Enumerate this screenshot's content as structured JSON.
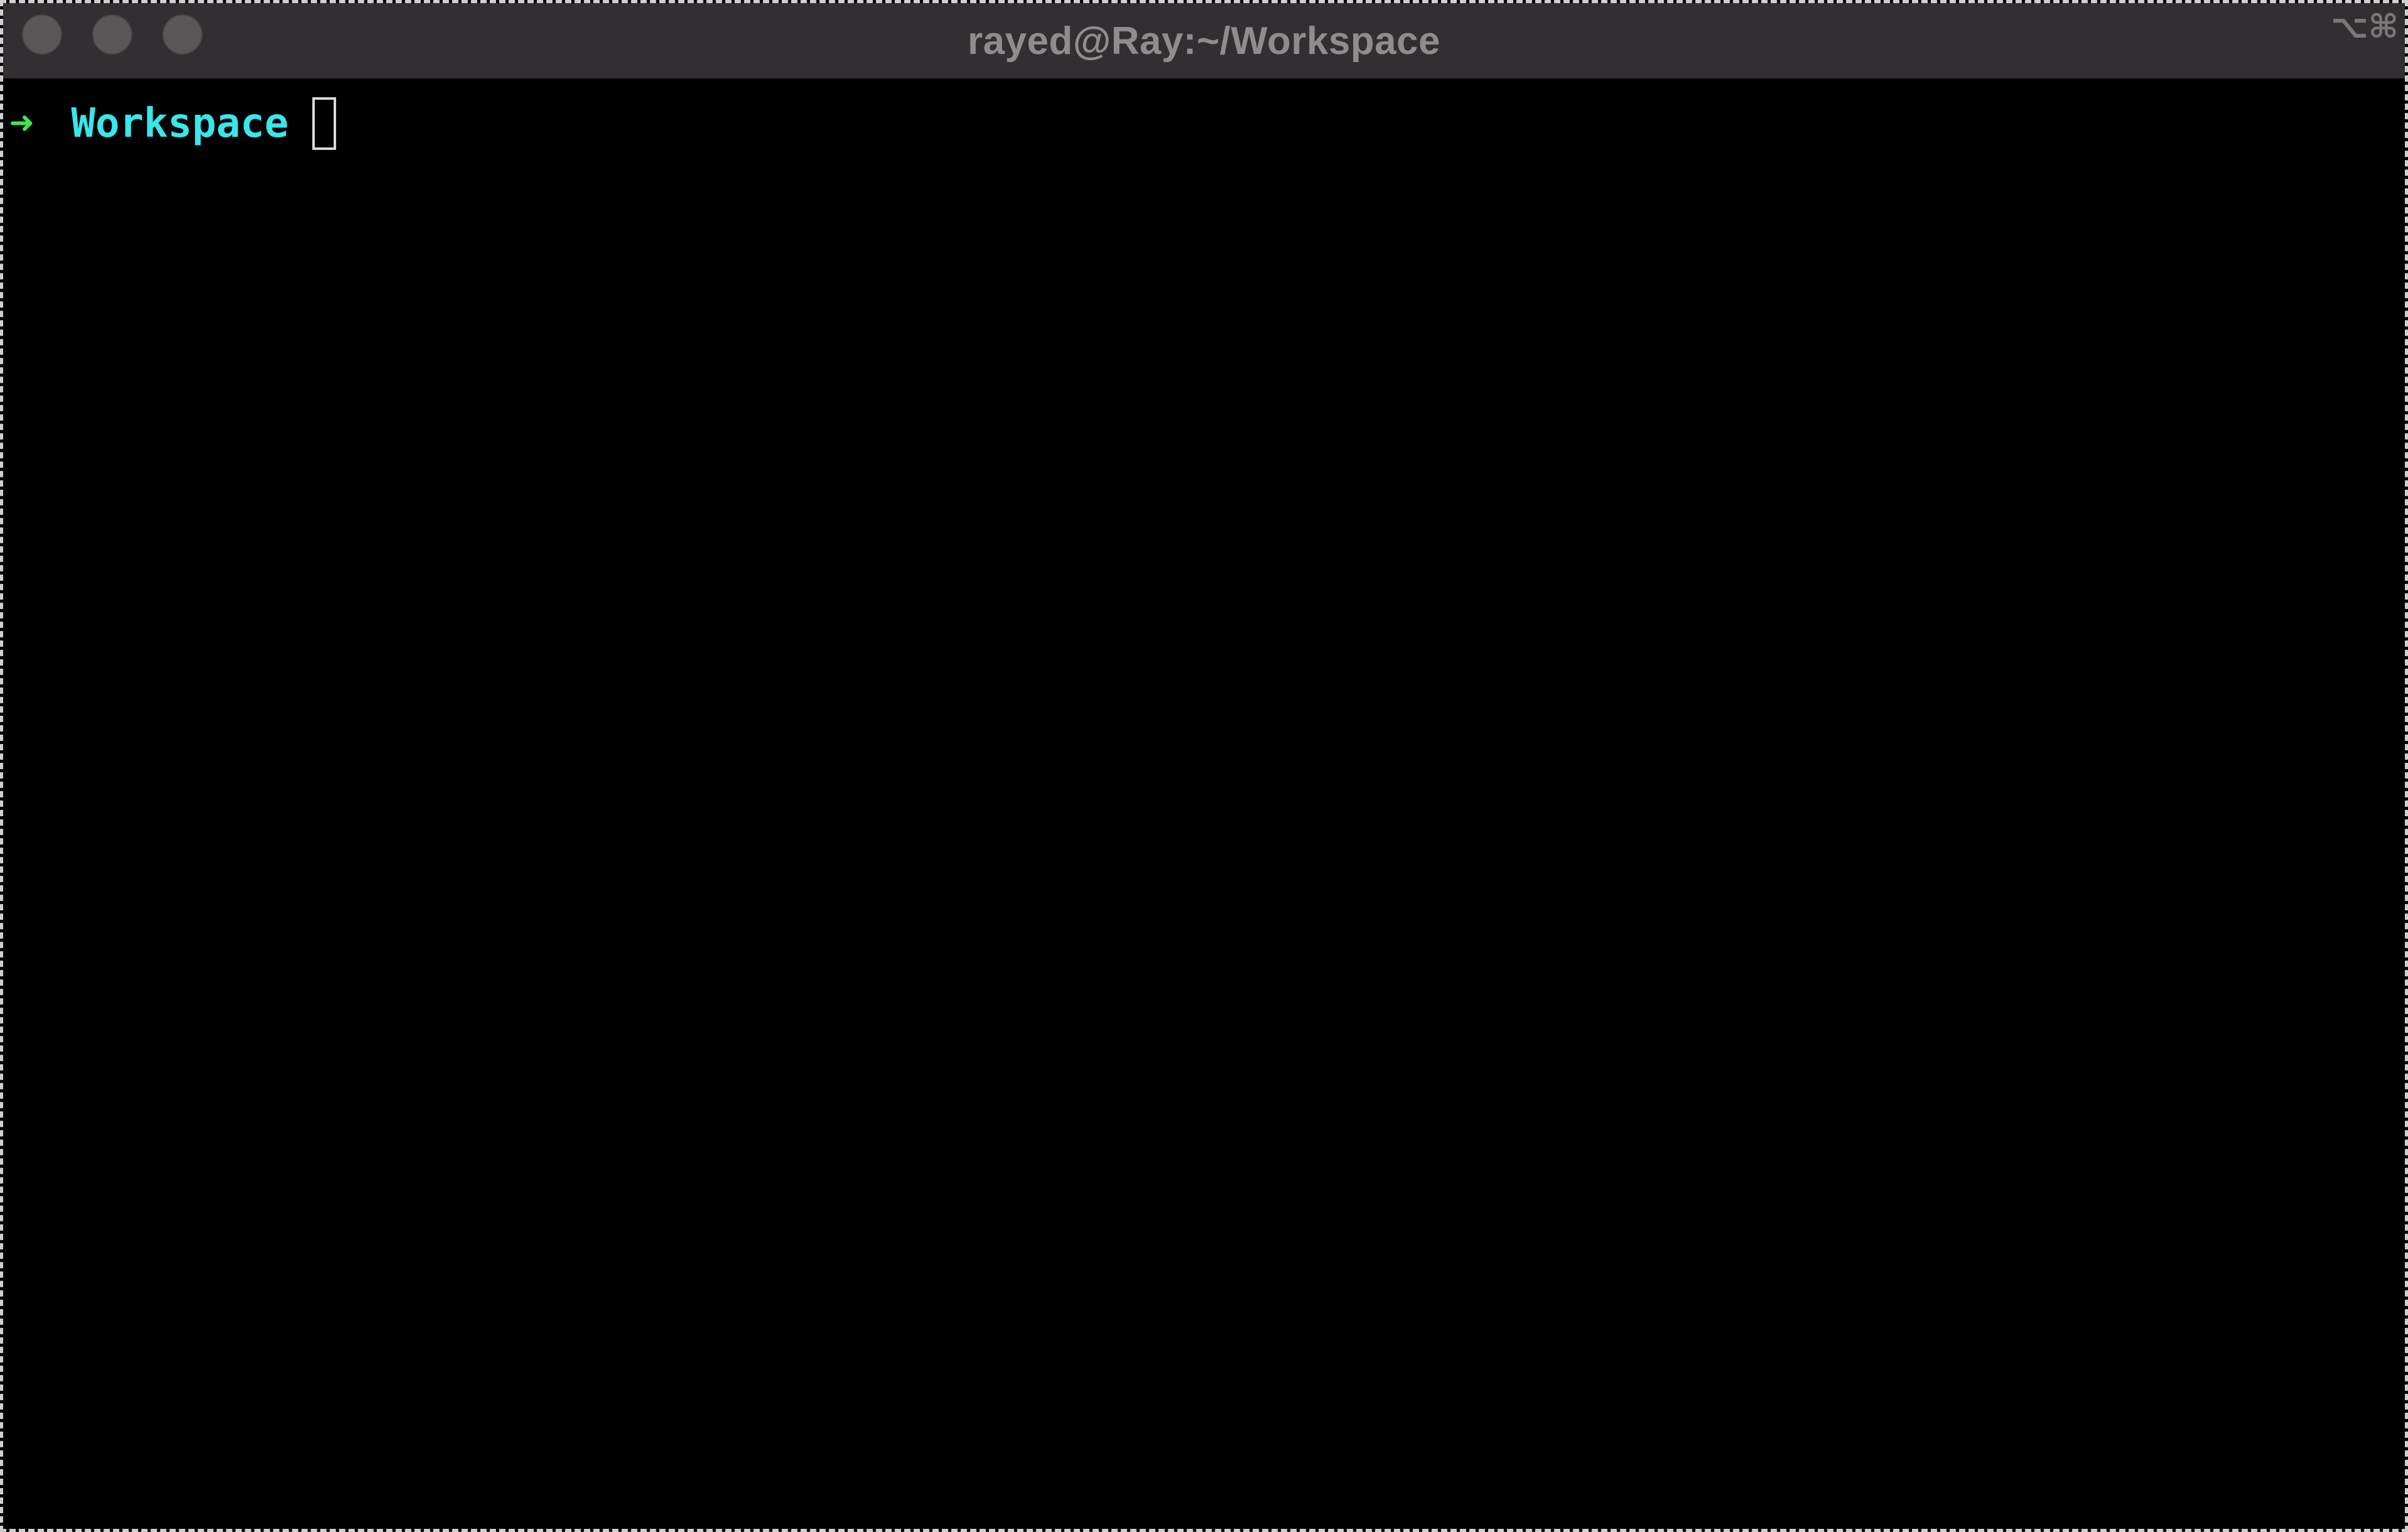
{
  "window": {
    "title": "rayed@Ray:~/Workspace",
    "shortcut": "⌥⌘"
  },
  "prompt": {
    "arrow": "➜",
    "directory": "Workspace",
    "input": ""
  },
  "colors": {
    "titlebar": "#322e31",
    "arrow": "#3ee84f",
    "directory": "#39e6ea",
    "cursor": "#d8d8d8",
    "background": "#000000"
  }
}
